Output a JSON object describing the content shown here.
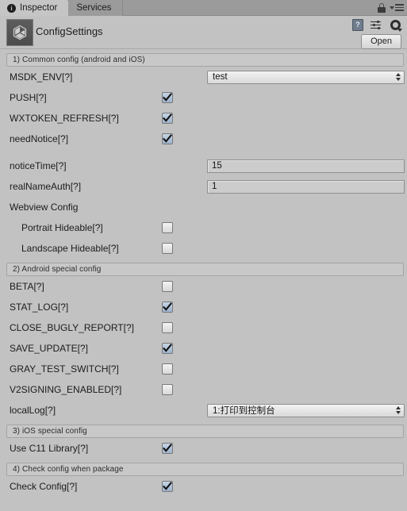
{
  "window": {
    "tabs": [
      {
        "label": "Inspector",
        "icon": "info-icon",
        "active": true
      },
      {
        "label": "Services",
        "icon": "",
        "active": false
      }
    ],
    "lock_icon": "lock-icon",
    "menu_icon": "hamburger-menu-icon"
  },
  "header": {
    "object_title": "ConfigSettings",
    "object_icon": "unity-logo-icon",
    "help_icon": "help-book-icon",
    "preset_icon": "preset-settings-icon",
    "gear_icon": "gear-icon",
    "open_label": "Open"
  },
  "sections": [
    {
      "title": "1) Common config (android and iOS)",
      "rows": [
        {
          "label": "MSDK_ENV[?]",
          "type": "popup",
          "value": "test",
          "name": "msdk-env"
        },
        {
          "label": "PUSH[?]",
          "type": "checkbox",
          "checked": true,
          "name": "push"
        },
        {
          "label": "WXTOKEN_REFRESH[?]",
          "type": "checkbox",
          "checked": true,
          "name": "wxtoken-refresh"
        },
        {
          "label": "needNotice[?]",
          "type": "checkbox",
          "checked": true,
          "name": "need-notice"
        },
        {
          "label": "",
          "type": "spacer",
          "name": "spacer-1"
        },
        {
          "label": "noticeTime[?]",
          "type": "field",
          "value": "15",
          "name": "notice-time"
        },
        {
          "label": "realNameAuth[?]",
          "type": "field",
          "value": "1",
          "name": "real-name-auth"
        },
        {
          "label": "Webview Config",
          "type": "group",
          "name": "webview-config"
        },
        {
          "label": "Portrait Hideable[?]",
          "type": "checkbox",
          "checked": false,
          "indent": true,
          "name": "portrait-hideable"
        },
        {
          "label": "Landscape Hideable[?]",
          "type": "checkbox",
          "checked": false,
          "indent": true,
          "name": "landscape-hideable"
        }
      ]
    },
    {
      "title": "2) Android special config",
      "rows": [
        {
          "label": "BETA[?]",
          "type": "checkbox",
          "checked": false,
          "name": "beta"
        },
        {
          "label": "STAT_LOG[?]",
          "type": "checkbox",
          "checked": true,
          "name": "stat-log"
        },
        {
          "label": "CLOSE_BUGLY_REPORT[?]",
          "type": "checkbox",
          "checked": false,
          "name": "close-bugly-report"
        },
        {
          "label": "SAVE_UPDATE[?]",
          "type": "checkbox",
          "checked": true,
          "name": "save-update"
        },
        {
          "label": "GRAY_TEST_SWITCH[?]",
          "type": "checkbox",
          "checked": false,
          "name": "gray-test-switch"
        },
        {
          "label": "V2SIGNING_ENABLED[?]",
          "type": "checkbox",
          "checked": false,
          "name": "v2signing-enabled"
        },
        {
          "label": "localLog[?]",
          "type": "popup",
          "value": "1:打印到控制台",
          "name": "local-log"
        }
      ]
    },
    {
      "title": "3) iOS special config",
      "rows": [
        {
          "label": "Use C11 Library[?]",
          "type": "checkbox",
          "checked": true,
          "name": "use-c11-library"
        }
      ]
    },
    {
      "title": "4) Check config when package",
      "rows": [
        {
          "label": "Check Config[?]",
          "type": "checkbox",
          "checked": true,
          "name": "check-config"
        }
      ]
    }
  ],
  "colors": {
    "background": "#c2c2c2",
    "tabbar": "#9b9b9b",
    "tab_active": "#c5c5c5",
    "checkbox_on": "#9db3cc",
    "text": "#1c1c1c"
  }
}
